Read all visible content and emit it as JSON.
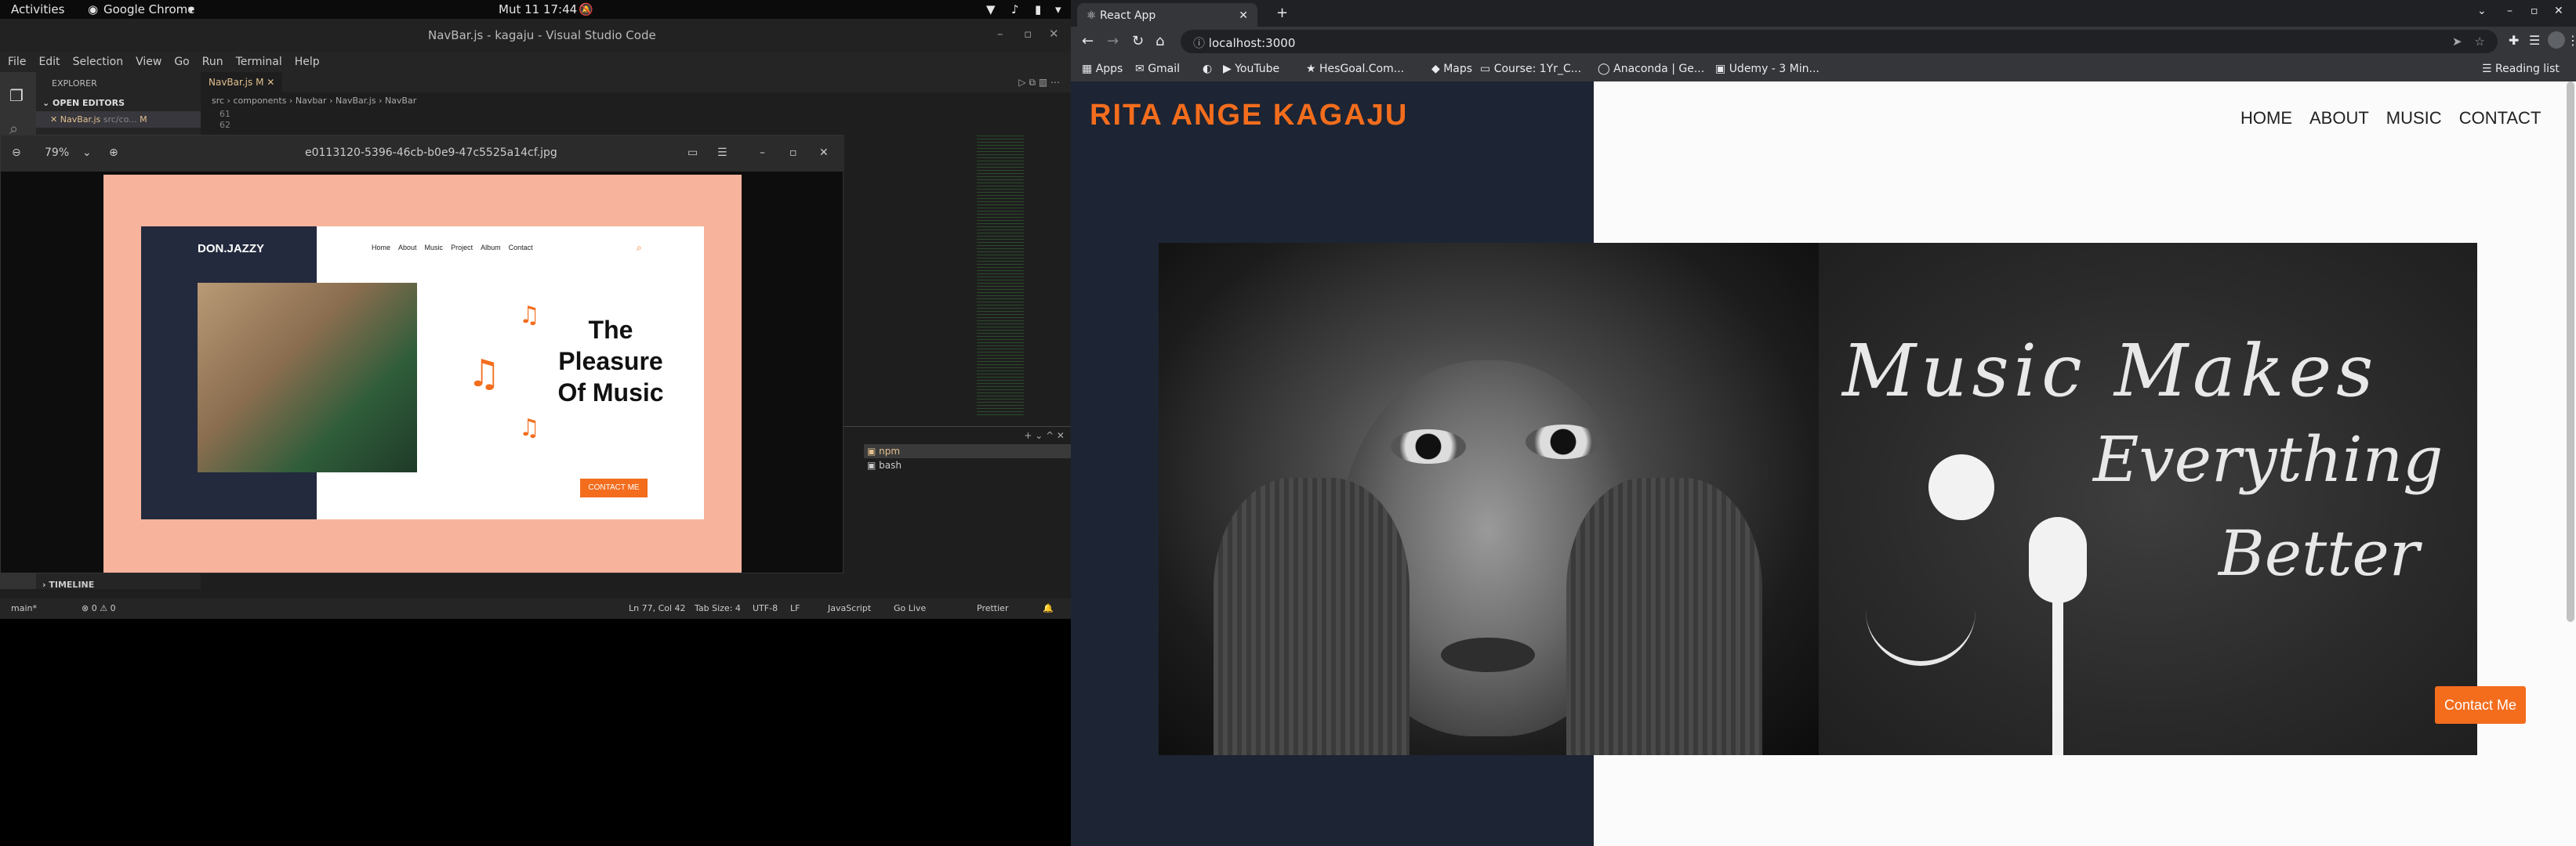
{
  "topbar": {
    "activities": "Activities",
    "app": "Google Chrome",
    "clock": "Mut 11  17:44"
  },
  "vscode": {
    "title": "NavBar.js - kagaju - Visual Studio Code",
    "menu": [
      "File",
      "Edit",
      "Selection",
      "View",
      "Go",
      "Run",
      "Terminal",
      "Help"
    ],
    "explorer": {
      "header": "EXPLORER",
      "open_editors": "OPEN EDITORS",
      "file": "NavBar.js",
      "file_path": "src/co...",
      "badge": "M",
      "timeline": "TIMELINE"
    },
    "tab": {
      "label": "NavBar.js",
      "badge": "M"
    },
    "breadcrumb": [
      "src",
      "components",
      "Navbar",
      "NavBar.js",
      "NavBar"
    ],
    "line_numbers": [
      "61",
      "62"
    ],
    "terminal": {
      "items": [
        "npm",
        "bash"
      ]
    },
    "status": {
      "branch": "main*",
      "problems": "⊗ 0 ⚠ 0",
      "position": "Ln 77, Col 42",
      "tab_size": "Tab Size: 4",
      "encoding": "UTF-8",
      "eol": "LF",
      "language": "JavaScript",
      "golive": "Go Live",
      "prettier": "Prettier"
    }
  },
  "viewer": {
    "zoom": "79%",
    "filename": "e0113120-5396-46cb-b0e9-47c5525a14cf.jpg",
    "design": {
      "logo": "DON.JAZZY",
      "nav": [
        "Home",
        "About",
        "Music",
        "Project",
        "Album",
        "Contact"
      ],
      "headline": [
        "The",
        "Pleasure",
        "Of Music"
      ],
      "button": "CONTACT ME"
    }
  },
  "chrome": {
    "tab_title": "React App",
    "url": "localhost:3000",
    "bookmarks": [
      "Apps",
      "Gmail",
      "YouTube",
      "HesGoal.Com...",
      "Maps",
      "Course: 1Yr_C...",
      "Anaconda | Ge...",
      "Udemy - 3 Min..."
    ],
    "reading_list": "Reading list"
  },
  "site": {
    "brand": "RITA ANGE KAGAJU",
    "nav": [
      "HOME",
      "ABOUT",
      "MUSIC",
      "CONTACT"
    ],
    "hero_text": [
      "Music Makes",
      "Everything",
      "Better"
    ],
    "contact_button": "Contact Me"
  },
  "colors": {
    "accent": "#f36d1d",
    "dark_panel": "#1d2433",
    "peach": "#f8b39c"
  }
}
